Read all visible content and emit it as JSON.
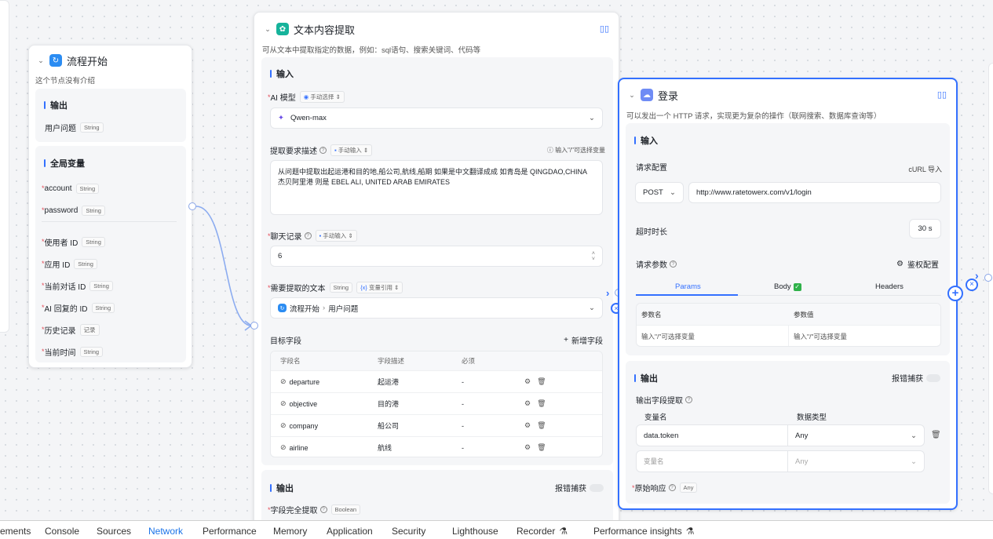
{
  "start_node": {
    "title": "流程开始",
    "desc": "这个节点没有介绍",
    "output": {
      "title": "输出",
      "fields": [
        {
          "name": "用户问题",
          "type": "String"
        }
      ]
    },
    "global": {
      "title": "全局变量",
      "fields_a": [
        {
          "name": "account",
          "type": "String"
        },
        {
          "name": "password",
          "type": "String"
        }
      ],
      "fields_b": [
        {
          "name": "使用者 ID",
          "type": "String"
        },
        {
          "name": "应用 ID",
          "type": "String"
        },
        {
          "name": "当前对话 ID",
          "type": "String"
        },
        {
          "name": "AI 回复的 ID",
          "type": "String"
        },
        {
          "name": "历史记录",
          "type": "记录"
        },
        {
          "name": "当前时间",
          "type": "String"
        }
      ]
    }
  },
  "extract_node": {
    "title": "文本内容提取",
    "desc": "可从文本中提取指定的数据，例如：sql语句、搜索关键词、代码等",
    "input_title": "输入",
    "ai_model_label": "AI 模型",
    "ai_model_mode": "手动选择",
    "ai_model_value": "Qwen-max",
    "requirement_label": "提取要求描述",
    "requirement_mode": "手动输入",
    "requirement_hint": "输入\"/\"可选择变量",
    "requirement_text": "从问题中提取出起运港和目的地,船公司,航线,船期 如果是中文翻译成成 如青岛是 QINGDAO,CHINA  杰贝阿里港 则是 EBEL ALI, UNITED ARAB EMIRATES",
    "history_label": "聊天记录",
    "history_mode": "手动输入",
    "history_value": "6",
    "text_label": "需要提取的文本",
    "text_type": "String",
    "text_mode": "变量引用",
    "text_source": "流程开始",
    "text_field": "用户问题",
    "target_label": "目标字段",
    "add_field": "新增字段",
    "columns": [
      "字段名",
      "字段描述",
      "必须"
    ],
    "rows": [
      {
        "name": "departure",
        "desc": "起运港",
        "required": "-"
      },
      {
        "name": "objective",
        "desc": "目的港",
        "required": "-"
      },
      {
        "name": "company",
        "desc": "船公司",
        "required": "-"
      },
      {
        "name": "airline",
        "desc": "航线",
        "required": "-"
      }
    ],
    "output_title": "输出",
    "error_catch": "报错捕获",
    "complete_label": "字段完全提取",
    "complete_type": "Boolean"
  },
  "login_node": {
    "title": "登录",
    "desc": "可以发出一个 HTTP 请求，实现更为复杂的操作（联网搜索、数据库查询等）",
    "input_title": "输入",
    "request_config": "请求配置",
    "curl_import": "cURL 导入",
    "method": "POST",
    "url": "http://www.ratetowerx.com/v1/login",
    "timeout_label": "超时时长",
    "timeout_value": "30 s",
    "params_label": "请求参数",
    "auth_label": "鉴权配置",
    "tabs": [
      "Params",
      "Body",
      "Headers"
    ],
    "param_cols": [
      "参数名",
      "参数值"
    ],
    "param_placeholders": [
      "输入\"/\"可选择变量",
      "输入\"/\"可选择变量"
    ],
    "output_title": "输出",
    "error_catch": "报错捕获",
    "extract_label": "输出字段提取",
    "out_cols": [
      "变量名",
      "数据类型"
    ],
    "out_rows": [
      {
        "name": "data.token",
        "type": "Any"
      }
    ],
    "out_placeholder_name": "变量名",
    "out_placeholder_type": "Any",
    "raw_label": "原始响应",
    "raw_type": "Any"
  },
  "devtools": {
    "tabs": [
      "ements",
      "Console",
      "Sources",
      "Network",
      "Performance",
      "Memory",
      "Application",
      "Security",
      "Lighthouse",
      "Recorder",
      "Performance insights"
    ],
    "active": "Network"
  },
  "colors": {
    "accent": "#3370ff",
    "extract_icon": "#16b39b",
    "start_icon": "#2b8cf2",
    "login_icon": "#6f8cf5"
  }
}
